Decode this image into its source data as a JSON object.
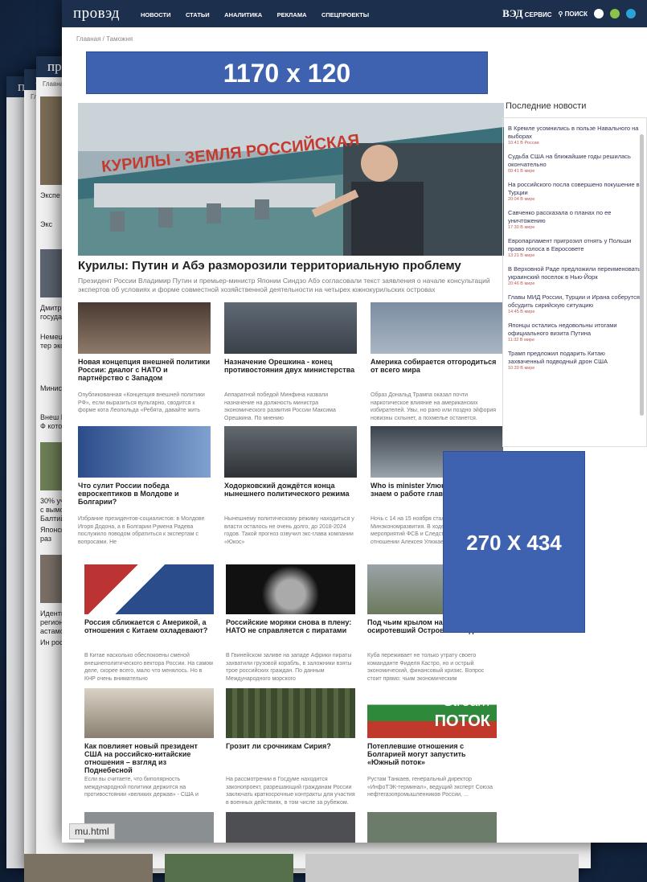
{
  "main": {
    "logo": "провэд",
    "nav": [
      "НОВОСТИ",
      "СТАТЬИ",
      "АНАЛИТИКА",
      "РЕКЛАМА",
      "СПЕЦПРОЕКТЫ"
    ],
    "service_logo": "ВЭД",
    "service_label": "СЕРВИС",
    "search_label": "ПОИСК",
    "breadcrumb": [
      "Главная",
      "Таможня"
    ],
    "banner_top": "1170 х 120",
    "hero": {
      "sign_text": "КУРИЛЫ - ЗЕМЛЯ РОССИЙСКАЯ",
      "title": "Курилы: Путин и Абэ разморозили территориальную проблему",
      "lead": "Президент России Владимир Путин и премьер-министр Японии Синдзо Абэ согласовали текст заявления о начале консультаций экспертов об условиях и форме совместной хозяйственной деятельности на четырех южнокурильских островах"
    },
    "cards": [
      {
        "title": "Новая концепция внешней политики России: диалог с НАТО и партнёрство с Западом",
        "desc": "Опубликованная «Концепция внешней политики РФ», если выразиться вульгарно, сводится к форме кота Леопольда «Ребята, давайте жить"
      },
      {
        "title": "Назначение Орешкина - конец противостояния двух министерства",
        "desc": "Аппаратной победой Минфина назвали назначение на должность министра экономического развития России Максима Орешкина. По мнению"
      },
      {
        "title": "Америка собирается отгородиться от всего мира",
        "desc": "Образ Дональд Трампа оказал почти наркотическое влияние на американских избирателей. Увы, но рано или поздно эйфория новизны схлынет, а похмелье останется. Похмелье воздействие"
      },
      {
        "title": "Что сулит России победа еврoскептиков в Молдове и Болгарии?",
        "desc": "Избрание президентов-социалистов: в Молдове Игоря Додона, а в Болгарии Румена Радева послужило поводом обратиться к экспертам с вопросами. Не"
      },
      {
        "title": "Ходорковский дождётся конца нынешнего политического режима",
        "desc": "Нынешнему политическому режиму находиться у власти осталось не очень долго, до 2018-2024 годов. Такой прогноз озвучил экс-глава компании «Юкос»"
      },
      {
        "title": "Who is minister Улюкаев – что мы знаем о работе главы Минэка?",
        "desc": "Ночь с 14 на 15 ноября стала роковой для главы Минэкономразвития. В ходе оперативных мероприятий ФСБ и Следственного комитета в отношении Алексея Улюкаева возбудили уголовное"
      }
    ],
    "cards2": [
      {
        "title": "Россия сближается с Америкой, а отношения с Китаем охладевают?",
        "desc": "В Китае насколько обеспокоены сменой внешнеполитического вектора России. На самом деле, скорее всего, мало что менялось. Но в КНР очень внимательно"
      },
      {
        "title": "Российские моряки снова в плену: НАТО не справляется с пиратами",
        "desc": "В Гвинейском заливе на западе Африки пираты захватили грузовой корабль, в заложники взяты трое российских граждан. По данным Международного морского"
      },
      {
        "title": "Под чьим крылом найдёт утешение осиротевший Остров Свободы?",
        "desc": "Куба переживает не только утрату своего команданте Фиделя Кастро, но и острый экономический, финансовый кризис. Вопрос стоит прямо: чьим экономическим"
      },
      {
        "title": "Как повлияет новый президент США на российско-китайские отношения – взгляд из Поднебесной",
        "desc": "Если вы считаете, что биполярность международной политики держится на противостоянии «великих держав» - США и"
      },
      {
        "title": "Грозит ли срочникам Сирия?",
        "desc": "На рассмотрении в Госдуме находится законопроект, разрешающий гражданам России заключать краткосрочные контракты для участия в военных действиях, в том числе за рубежом. Закон"
      },
      {
        "title": "Потеплевшие отношения с Болгарией могут запустить «Южный поток»",
        "desc": "Рустам Танкаев, генеральный директор «ИнфоТЭК-терминал», ведущий эксперт Союза нефтегазопромышленников России, ..."
      }
    ],
    "sidebar": {
      "title": "Последние новости",
      "items": [
        {
          "t": "В Кремле усомнились в пользе Навального на выборах",
          "d": "10:41 В России"
        },
        {
          "t": "Судьба США на ближайшие годы решилась окончательно",
          "d": "09:41 В мире"
        },
        {
          "t": "На российского посла совершено покушение в Турции",
          "d": "20:04 В мире"
        },
        {
          "t": "Савченко рассказала о планах по ее уничтожению",
          "d": "17:30 В мире"
        },
        {
          "t": "Европарламент пригрозил отнять у Польши право голоса в Евросовете",
          "d": "13:21 В мире"
        },
        {
          "t": "В Верховной Раде предложили переименовать украинский поселок в Нью-Йорк",
          "d": "20:46 В мире"
        },
        {
          "t": "Главы МИД России, Турции и Ирана соберутся обсудить сирийскую ситуацию",
          "d": "14:45 В мире"
        },
        {
          "t": "Японцы остались недовольны итогами официального визита Путина",
          "d": "11:32 В мире"
        },
        {
          "t": "Трамп предложил подарить Китаю захваченный подводный дрон США",
          "d": "10:39 В мире"
        }
      ]
    },
    "banner_side": "270 X 434",
    "stream_text": "Stream",
    "potok_text": "ПОТОК"
  },
  "back": {
    "logo": "про",
    "crumb": "Главная",
    "texts": [
      "Экспе",
      "Экс",
      "Дмитрий государ",
      "Немец потер эконо",
      "Минист",
      "Внеш КЮФ котор",
      "30% учас с вымога Балтийск",
      "Японские раз",
      "Идентиф регионе растамо",
      "Ин рос"
    ]
  },
  "file_tab": "mu.html",
  "colors": {
    "topbar": "#1c2f4c",
    "banner": "#3f62b0",
    "background": "#142540"
  }
}
